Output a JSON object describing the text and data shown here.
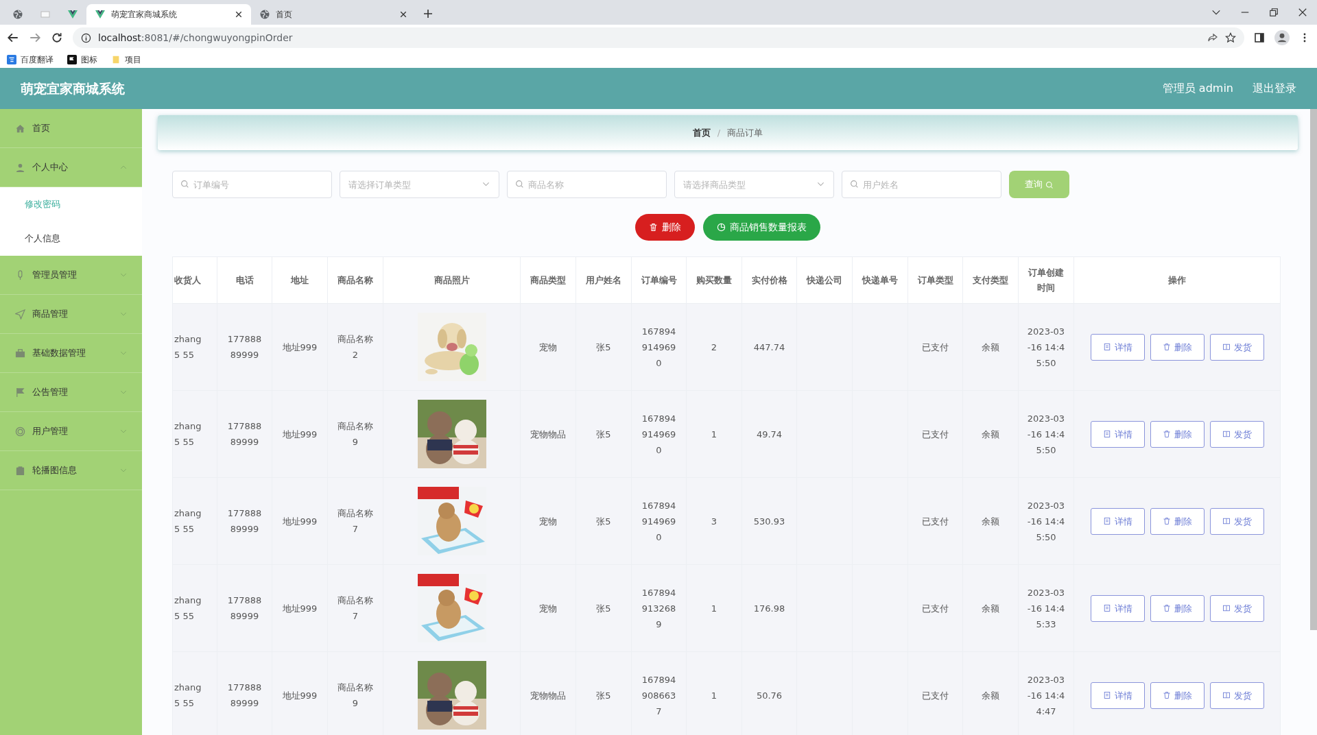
{
  "browser": {
    "tabs": [
      {
        "kind": "pinned",
        "selected": false
      },
      {
        "kind": "pinned",
        "selected": false
      },
      {
        "kind": "pinned",
        "selected": false
      },
      {
        "kind": "page",
        "title": "萌宠宜家商城系统",
        "selected": true
      },
      {
        "kind": "page",
        "title": "首页",
        "selected": false
      }
    ],
    "url_host": "localhost",
    "url_rest": ":8081/#/chongwuyongpinOrder",
    "bookmarks": [
      {
        "label": "百度翻译"
      },
      {
        "label": "图标"
      },
      {
        "label": "项目"
      }
    ]
  },
  "app": {
    "title": "萌宠宜家商城系统",
    "user": "管理员 admin",
    "logout": "退出登录"
  },
  "sidebar": {
    "items": [
      {
        "kind": "link",
        "label": "首页"
      },
      {
        "kind": "menu",
        "label": "个人中心",
        "expanded": true,
        "children": [
          {
            "label": "修改密码",
            "selected": true
          },
          {
            "label": "个人信息",
            "selected": false
          }
        ]
      },
      {
        "kind": "menu",
        "label": "管理员管理",
        "expanded": false
      },
      {
        "kind": "menu",
        "label": "商品管理",
        "expanded": false
      },
      {
        "kind": "menu",
        "label": "基础数据管理",
        "expanded": false
      },
      {
        "kind": "menu",
        "label": "公告管理",
        "expanded": false
      },
      {
        "kind": "menu",
        "label": "用户管理",
        "expanded": false
      },
      {
        "kind": "menu",
        "label": "轮播图信息",
        "expanded": false
      }
    ]
  },
  "breadcrumb": [
    "首页",
    "商品订单"
  ],
  "breadcrumb_separator": "/",
  "filters": [
    {
      "kind": "input",
      "placeholder": "订单编号"
    },
    {
      "kind": "select",
      "placeholder": "请选择订单类型"
    },
    {
      "kind": "input",
      "placeholder": "商品名称"
    },
    {
      "kind": "select",
      "placeholder": "请选择商品类型"
    },
    {
      "kind": "input",
      "placeholder": "用户姓名"
    }
  ],
  "search_button": "查询",
  "actions": [
    {
      "kind": "danger",
      "label": "删除"
    },
    {
      "kind": "success",
      "label": "商品销售数量报表"
    }
  ],
  "table": {
    "columns": [
      "收货人",
      "电话",
      "地址",
      "商品名称",
      "商品照片",
      "商品类型",
      "用户姓名",
      "订单编号",
      "购买数量",
      "实付价格",
      "快递公司",
      "快递单号",
      "订单类型",
      "支付类型",
      "订单创建时间",
      "操作"
    ],
    "rows": [
      {
        "cells": [
          "zhang 5 55",
          "17788889999",
          "地址999",
          "商品名称2",
          {
            "kind": "picture"
          },
          "宠物",
          "张5",
          "1678949149690",
          "2",
          "447.74",
          null,
          null,
          "已支付",
          "余额",
          "2023-03-16 14:45:50"
        ],
        "actions": [
          "详情",
          "删除",
          "发货"
        ]
      },
      {
        "cells": [
          "zhang 5 55",
          "17788889999",
          "地址999",
          "商品名称9",
          {
            "kind": "picture"
          },
          "宠物物品",
          "张5",
          "1678949149690",
          "1",
          "49.74",
          null,
          null,
          "已支付",
          "余额",
          "2023-03-16 14:45:50"
        ],
        "actions": [
          "详情",
          "删除",
          "发货"
        ]
      },
      {
        "cells": [
          "zhang 5 55",
          "17788889999",
          "地址999",
          "商品名称7",
          {
            "kind": "picture"
          },
          "宠物",
          "张5",
          "1678949149690",
          "3",
          "530.93",
          null,
          null,
          "已支付",
          "余额",
          "2023-03-16 14:45:50"
        ],
        "actions": [
          "详情",
          "删除",
          "发货"
        ]
      },
      {
        "cells": [
          "zhang 5 55",
          "17788889999",
          "地址999",
          "商品名称7",
          {
            "kind": "picture"
          },
          "宠物",
          "张5",
          "1678949132689",
          "1",
          "176.98",
          null,
          null,
          "已支付",
          "余额",
          "2023-03-16 14:45:33"
        ],
        "actions": [
          "详情",
          "删除",
          "发货"
        ]
      },
      {
        "cells": [
          "zhang 5 55",
          "17788889999",
          "地址999",
          "商品名称9",
          {
            "kind": "picture"
          },
          "宠物物品",
          "张5",
          "1678949086637",
          "1",
          "50.76",
          null,
          null,
          "已支付",
          "余额",
          "2023-03-16 14:44:47"
        ],
        "actions": [
          "详情",
          "删除",
          "发货"
        ]
      }
    ]
  }
}
